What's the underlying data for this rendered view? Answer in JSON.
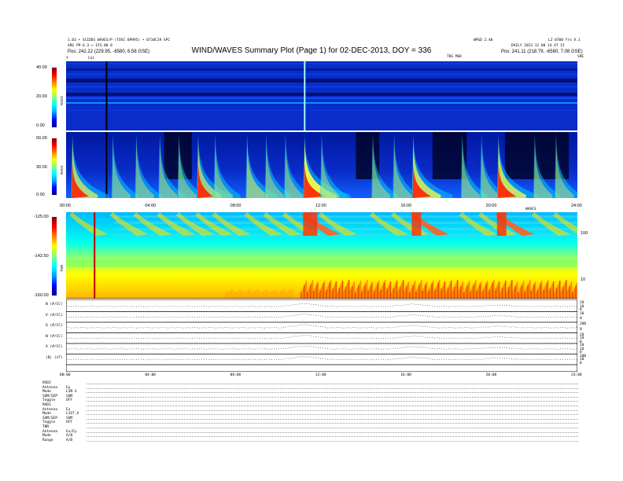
{
  "header": {
    "left_line1": "1.03 • SCIDDS WAVES/P (TOSC 09995) • 0710C19 SPC",
    "left_line2": "ARG FM 6.3 + 155.00 0",
    "left_line3": "Pos: 242.22 (229.95, -6580, 6.58 GSE)",
    "center_title": "WIND/WAVES Summary Plot (Page 1) for 02-DEC-2013, DOY = 336",
    "right_top_a": "WPGD 2.40",
    "right_top_b": "LZ 0700 fro V.1",
    "right_line2": "DAILY 2013 12 00 14 47 15",
    "right_line3": "Pos: 241.11 (218.79, -6580, 7.08 GSE)",
    "sub_left_y": "Y",
    "sub_left_cal": "Cal",
    "sub_center": "TDS MSK",
    "sub_right": "SRE"
  },
  "chart_data": [
    {
      "type": "heatmap",
      "name": "RAD2",
      "colorbar_ticks": [
        "40.00",
        "20.00",
        "0.00"
      ],
      "colorbar_label": "RAD2",
      "features": [
        {
          "time_hr": 1.9,
          "kind": "cal"
        },
        {
          "time_hr": 11.2,
          "kind": "burst"
        }
      ]
    },
    {
      "type": "heatmap",
      "name": "RAD1",
      "colorbar_ticks": [
        "60.00",
        "30.00",
        "0.00"
      ],
      "colorbar_label": "RAD1",
      "x_ticks": [
        "00:00",
        "04:00",
        "08:00",
        "12:00",
        "16:00",
        "20:00",
        "24:00"
      ],
      "x_tick_values": [
        0,
        4,
        8,
        12,
        16,
        20,
        24
      ],
      "xlim": [
        0,
        24
      ],
      "bursts_hr": [
        0.3,
        2.2,
        3.3,
        4.4,
        5.3,
        6.2,
        7.0,
        8.5,
        9.4,
        10.3,
        11.2,
        12.0,
        14.4,
        15.4,
        16.3,
        18.6,
        19.5,
        20.3,
        22.0,
        23.0
      ]
    },
    {
      "type": "heatmap",
      "name": "TNR",
      "colorbar_ticks": [
        "-125.00",
        "-142.50",
        "-160.00"
      ],
      "colorbar_label": "TNR",
      "right_label": "WAVES",
      "right_ticks": [
        "100",
        "10"
      ],
      "xlim": [
        0,
        24
      ]
    },
    {
      "type": "line",
      "name": "SWE / MFI",
      "series": [
        {
          "name": "N (#/CC)",
          "scale": [
            "20",
            "10",
            "0"
          ]
        },
        {
          "name": "V (#/CC)",
          "scale": [
            "10",
            "0"
          ]
        },
        {
          "name": "Q (#/CC)",
          "scale": [
            "200",
            "0"
          ]
        },
        {
          "name": "N (#/CC)",
          "scale": [
            "20",
            "10",
            "0"
          ]
        },
        {
          "name": "A (#/CC)",
          "scale": [
            "10",
            "10",
            "0"
          ]
        },
        {
          "name": "|B| (nT)",
          "scale": [
            "100",
            "10",
            "0"
          ]
        }
      ],
      "x_ticks": [
        "00:00",
        "04:00",
        "08:00",
        "12:00",
        "16:00",
        "20:00",
        "24:00"
      ],
      "x_tick_values": [
        0,
        4,
        8,
        12,
        16,
        20,
        24
      ],
      "xlim": [
        0,
        24
      ]
    }
  ],
  "left_info": [
    {
      "label": "RAD2",
      "value": ""
    },
    {
      "label": "Antenna",
      "value": "Ey"
    },
    {
      "label": "Mode",
      "value": "LIN S"
    },
    {
      "label": "SUM/SEP",
      "value": "SUM"
    },
    {
      "label": "Toggle",
      "value": "OFF"
    },
    {
      "label": "RAD1",
      "value": ""
    },
    {
      "label": "Antenna",
      "value": "Ex"
    },
    {
      "label": "Mode",
      "value": "LIST_A"
    },
    {
      "label": "SUM/SEP",
      "value": "SUM"
    },
    {
      "label": "Toggle",
      "value": "OFF"
    },
    {
      "label": "TNR",
      "value": ""
    },
    {
      "label": "Antenna",
      "value": "Ex/Ey"
    },
    {
      "label": "Mode",
      "value": "A/B"
    },
    {
      "label": "Range",
      "value": "A/B"
    }
  ],
  "colors": {
    "background": "#0a2cc8",
    "colormap": [
      "#000080",
      "#0000ff",
      "#00a0ff",
      "#00ffff",
      "#80ff80",
      "#ffff00",
      "#ff8000",
      "#ff0000",
      "#800000"
    ]
  }
}
